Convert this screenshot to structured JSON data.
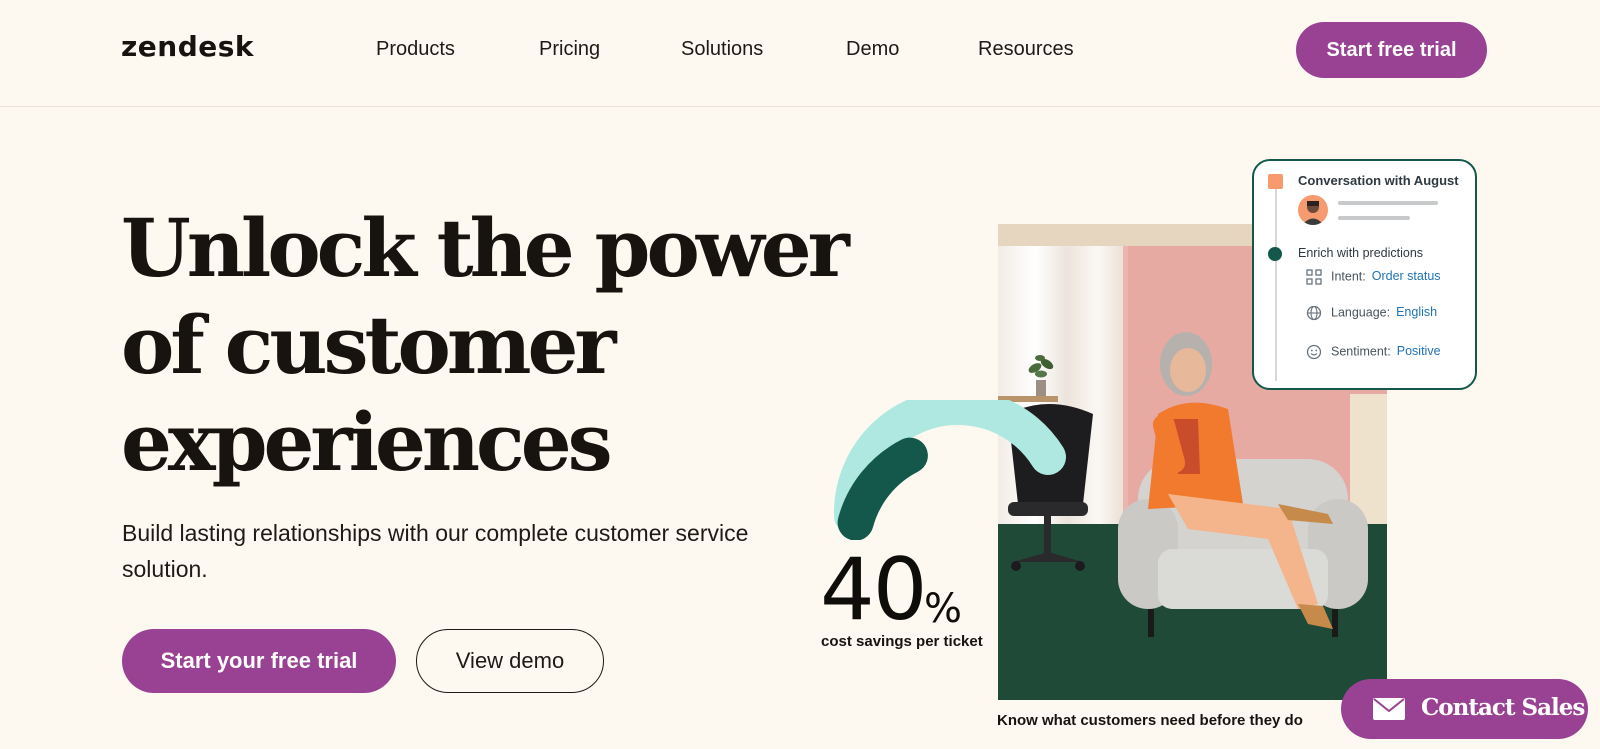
{
  "header": {
    "logo": "zendesk",
    "nav": [
      {
        "label": "Products"
      },
      {
        "label": "Pricing"
      },
      {
        "label": "Solutions"
      },
      {
        "label": "Demo"
      },
      {
        "label": "Resources"
      }
    ],
    "cta_label": "Start free trial"
  },
  "hero": {
    "title_lines": [
      "Unlock the power",
      "of customer",
      "experiences"
    ],
    "subtitle": "Build lasting relationships with our complete customer service solution.",
    "primary_cta": "Start your free trial",
    "secondary_cta": "View demo"
  },
  "stat": {
    "number": "40",
    "unit": "%",
    "label": "cost savings per ticket",
    "gauge_fraction": 0.4
  },
  "photo_caption": "Know what customers need before they do",
  "card": {
    "title": "Conversation with August",
    "enrich_label": "Enrich with predictions",
    "rows": [
      {
        "icon": "grid-icon",
        "label": "Intent:",
        "value": "Order status"
      },
      {
        "icon": "globe-icon",
        "label": "Language:",
        "value": "English"
      },
      {
        "icon": "smile-icon",
        "label": "Sentiment:",
        "value": "Positive"
      }
    ]
  },
  "contact": {
    "label": "Contact Sales",
    "icon": "mail-icon"
  },
  "colors": {
    "background": "#fdf9f1",
    "brand_purple": "#994294",
    "gauge_dark": "#13584a",
    "gauge_light": "#aee8e0",
    "card_border": "#13584a",
    "link_blue": "#1f73b7",
    "accent_orange": "#f79a6f"
  }
}
